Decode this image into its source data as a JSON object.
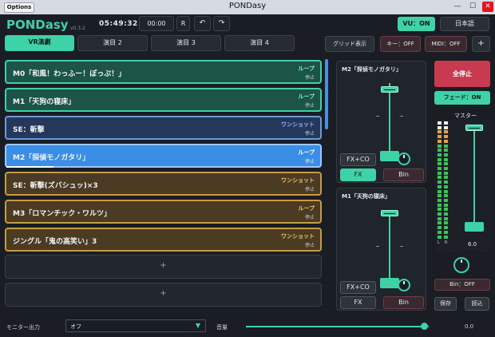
{
  "window": {
    "title": "PONDasy",
    "options_label": "Options",
    "minimize": "—",
    "maximize": "☐",
    "close": "✕"
  },
  "header": {
    "logo": "PONDasy",
    "version": "v0.3.2",
    "time": "05:49:32",
    "counter": "00:00",
    "r_label": "R",
    "undo_icon": "↶",
    "redo_icon": "↷",
    "vu_button": "VU：ON",
    "language_button": "日本語"
  },
  "tabs": [
    {
      "label": "VR演劇",
      "active": true
    },
    {
      "label": "演目 2",
      "active": false
    },
    {
      "label": "演目 3",
      "active": false
    },
    {
      "label": "演目 4",
      "active": false
    }
  ],
  "toolbar": {
    "grid_button": "グリッド表示",
    "key_button": "キー：OFF",
    "midi_button": "MIDI：OFF",
    "add_button": "+"
  },
  "cues": [
    {
      "name": "M0「和風！わっふー！ぽっぷ！」",
      "type": "ループ",
      "state": "停止",
      "style": "loop"
    },
    {
      "name": "M1「天狗の寝床」",
      "type": "ループ",
      "state": "停止",
      "style": "loop"
    },
    {
      "name": "SE：斬撃",
      "type": "ワンショット",
      "state": "停止",
      "style": "se"
    },
    {
      "name": "M2「探偵モノガタリ」",
      "type": "ループ",
      "state": "停止",
      "style": "active",
      "progress": 0.15
    },
    {
      "name": "SE：斬撃(ズバシュッ)×3",
      "type": "ワンショット",
      "state": "停止",
      "style": "brown"
    },
    {
      "name": "M3「ロマンチック・ワルツ」",
      "type": "ループ",
      "state": "停止",
      "style": "brown"
    },
    {
      "name": "ジングル「鬼の高笑い」3",
      "type": "ワンショット",
      "state": "停止",
      "style": "brown"
    }
  ],
  "empty_slot_label": "+",
  "mixer": {
    "channel1": {
      "title": "M2「探偵モノガタリ」",
      "fxco": "FX+CO",
      "fx": "FX",
      "bin": "Bin"
    },
    "channel2": {
      "title": "M1「天狗の寝床」",
      "fxco": "FX+CO",
      "fx": "FX",
      "bin": "Bin"
    }
  },
  "master": {
    "stop_all": "全停止",
    "fade": "フェード：ON",
    "label": "マスター",
    "value": "6.0",
    "meter_l": "L",
    "meter_r": "R",
    "bin_button": "Bin：OFF",
    "save": "保存",
    "load": "読込"
  },
  "footer": {
    "monitor_label": "モニター出力",
    "monitor_value": "オフ",
    "volume_label": "音量",
    "volume_value": "0.0",
    "volume_level": 0.97
  },
  "colors": {
    "accent": "#3ed2a6",
    "stop_all": "#c73a4f",
    "active_cue": "#3a8ee6"
  }
}
